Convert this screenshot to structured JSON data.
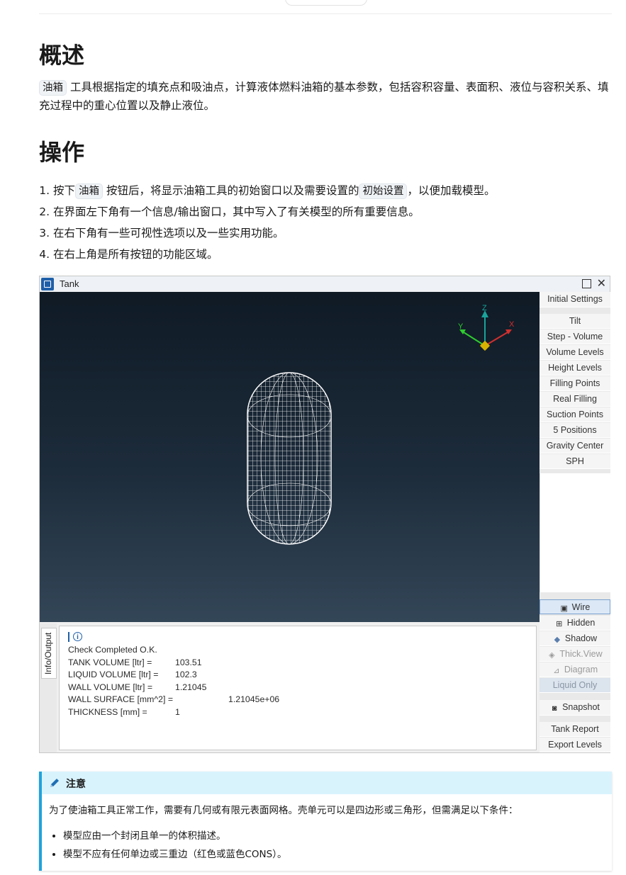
{
  "overview": {
    "heading": "概述",
    "tool_tag": "油箱",
    "text": "工具根据指定的填充点和吸油点，计算液体燃料油箱的基本参数，包括容积容量、表面积、液位与容积关系、填充过程中的重心位置以及静止液位。"
  },
  "operation": {
    "heading": "操作",
    "step1_a": "按下",
    "step1_tag": "油箱",
    "step1_b": "按钮后，将显示油箱工具的初始窗口以及需要设置的",
    "step1_tag2": "初始设置",
    "step1_c": "，以便加载模型。",
    "step2": "在界面左下角有一个信息/输出窗口，其中写入了有关模型的所有重要信息。",
    "step3": "在右下角有一些可视性选项以及一些实用功能。",
    "step4": "在右上角是所有按钮的功能区域。"
  },
  "window": {
    "title": "Tank",
    "axis": {
      "x": "X",
      "y": "Y",
      "z": "Z"
    },
    "top_buttons": [
      "Initial Settings",
      "Tilt",
      "Step - Volume",
      "Volume Levels",
      "Height Levels",
      "Filling Points",
      "Real Filling",
      "Suction Points",
      "5 Positions",
      "Gravity Center",
      "SPH"
    ],
    "view_buttons": {
      "wire": "Wire",
      "hidden": "Hidden",
      "shadow": "Shadow",
      "thickview": "Thick.View",
      "diagram": "Diagram",
      "liquid": "Liquid Only"
    },
    "snapshot": "Snapshot",
    "tank_report": "Tank Report",
    "export_levels": "Export Levels",
    "info_tab": "Info/Output",
    "info": {
      "status": "Check Completed  O.K.",
      "tank_volume_label": "TANK VOLUME [ltr] =",
      "tank_volume": "103.51",
      "liquid_volume_label": "LIQUID VOLUME [ltr] =",
      "liquid_volume": "102.3",
      "wall_volume_label": "WALL VOLUME [ltr] =",
      "wall_volume": "1.21045",
      "wall_surface_label": "WALL SURFACE [mm^2] =",
      "wall_surface": "1.21045e+06",
      "thickness_label": "THICKNESS [mm] =",
      "thickness": "1"
    }
  },
  "note": {
    "title": "注意",
    "body": "为了使油箱工具正常工作，需要有几何或有限元表面网格。壳单元可以是四边形或三角形，但需满足以下条件：",
    "bullets": [
      "模型应由一个封闭且单一的体积描述。",
      "模型不应有任何单边或三重边（红色或蓝色CONS）。"
    ]
  }
}
